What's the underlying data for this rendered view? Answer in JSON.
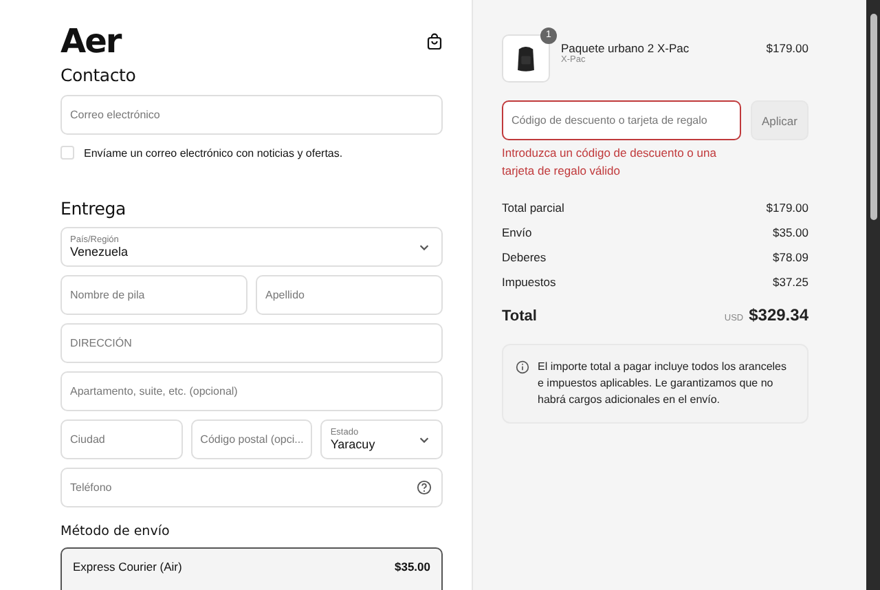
{
  "brand": {
    "logo": "Aer"
  },
  "contact": {
    "heading": "Contacto",
    "email": {
      "placeholder": "Correo electrónico"
    },
    "newsletter": {
      "label": "Envíame un correo electrónico con noticias y ofertas.",
      "checked": false
    }
  },
  "delivery": {
    "heading": "Entrega",
    "fields": [
      {
        "kind": "select",
        "label": "País/Región",
        "value": "Venezuela"
      },
      {
        "kind": "row",
        "items": [
          {
            "kind": "input",
            "placeholder": "Nombre de pila"
          },
          {
            "kind": "input",
            "placeholder": "Apellido"
          }
        ]
      },
      {
        "kind": "input",
        "placeholder": "DIRECCIÓN"
      },
      {
        "kind": "input",
        "placeholder": "Apartamento, suite, etc. (opcional)"
      },
      {
        "kind": "row",
        "items": [
          {
            "kind": "input",
            "placeholder": "Ciudad"
          },
          {
            "kind": "input",
            "placeholder": "Código postal (opci..."
          },
          {
            "kind": "select",
            "label": "Estado",
            "value": "Yaracuy"
          }
        ]
      },
      {
        "kind": "help",
        "placeholder": "Teléfono"
      }
    ]
  },
  "shipping": {
    "heading": "Método de envío",
    "options": [
      {
        "name": "Express Courier (Air)",
        "price": "$35.00",
        "selected": true
      }
    ]
  },
  "summary": {
    "items": [
      {
        "name": "Paquete urbano 2 X-Pac",
        "vendor": "X-Pac",
        "price": "$179.00",
        "quantity": "1"
      }
    ],
    "discount": {
      "placeholder": "Código de descuento o tarjeta de regalo",
      "button": "Aplicar",
      "error": "Introduzca un código de descuento o una tarjeta de regalo válido"
    },
    "lines": [
      {
        "label": "Total parcial",
        "value": "$179.00"
      },
      {
        "label": "Envío",
        "value": "$35.00"
      },
      {
        "label": "Deberes",
        "value": "$78.09"
      },
      {
        "label": "Impuestos",
        "value": "$37.25"
      }
    ],
    "total": {
      "label": "Total",
      "currency": "USD",
      "value": "$329.34"
    },
    "notice": "El importe total a pagar incluye todos los aranceles e impuestos aplicables. Le garantizamos que no habrá cargos adicionales en el envío."
  }
}
